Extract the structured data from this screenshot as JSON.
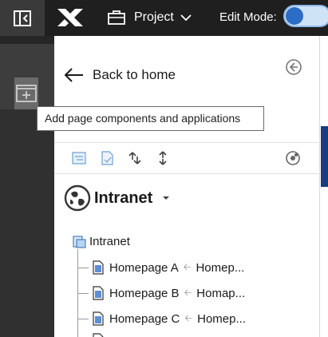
{
  "header": {
    "project_label": "Project",
    "edit_mode_label": "Edit Mode:",
    "edit_mode_on": true
  },
  "panel": {
    "back_label": "Back to home",
    "tooltip": "Add page components and applications",
    "site": {
      "name": "Intranet"
    },
    "tree": {
      "root": "Intranet",
      "items": [
        {
          "name": "Homepage A",
          "ref": "Homep..."
        },
        {
          "name": "Homepage B",
          "ref": "Homap..."
        },
        {
          "name": "Homepage C",
          "ref": "Homep..."
        }
      ]
    }
  },
  "colors": {
    "topbar": "#1f1f1f",
    "rail": "#303030",
    "toggle_fill": "#cfe3f7",
    "toggle_knob": "#2b6cc4",
    "accent_blue": "#173d7a"
  },
  "icons": [
    "sidebar-collapse-icon",
    "x-logo-icon",
    "briefcase-icon",
    "chevron-down-icon",
    "add-component-icon",
    "arrow-left-icon",
    "circle-arrow-left-icon",
    "tree-view-icon",
    "page-properties-icon",
    "move-up-down-icon",
    "move-item-icon",
    "site-settings-icon",
    "site-globe-icon",
    "caret-down-icon",
    "site-root-icon",
    "page-icon"
  ]
}
